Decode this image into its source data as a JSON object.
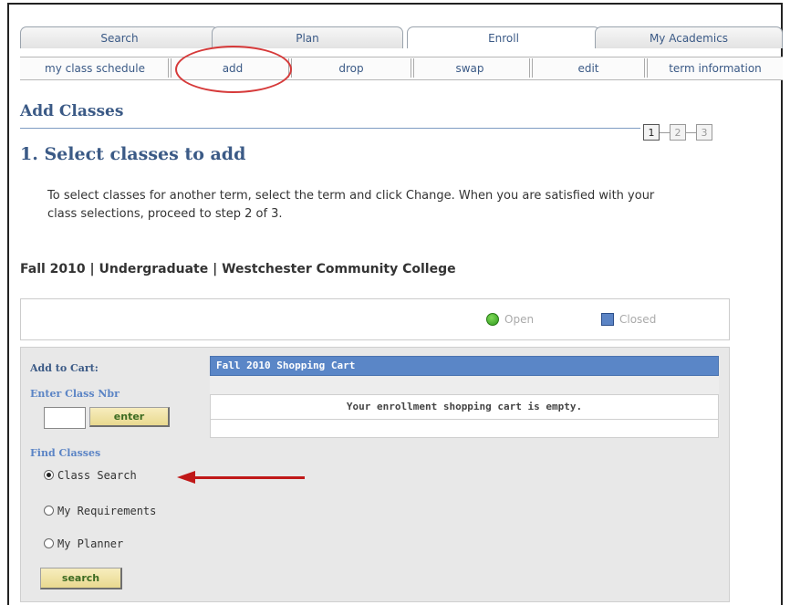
{
  "tabs": [
    "Search",
    "Plan",
    "Enroll",
    "My Academics"
  ],
  "active_tab": "Enroll",
  "subtabs": [
    "my class schedule",
    "add",
    "drop",
    "swap",
    "edit",
    "term information"
  ],
  "active_subtab": "add",
  "page_title": "Add Classes",
  "steps": [
    "1",
    "2",
    "3"
  ],
  "active_step": "1",
  "section_title": "1.  Select classes to add",
  "instructions": "To select classes for another term, select the term and click Change.  When you are satisfied with your class selections, proceed to step 2 of 3.",
  "term_info": "Fall 2010 | Undergraduate | Westchester Community College",
  "legend": {
    "open": "Open",
    "closed": "Closed"
  },
  "left_panel": {
    "add_to_cart": "Add to Cart:",
    "enter_class_nbr": "Enter Class Nbr",
    "enter_button": "enter",
    "find_classes": "Find Classes",
    "options": [
      "Class Search",
      "My Requirements",
      "My Planner"
    ],
    "selected_option": "Class Search",
    "search_button": "search"
  },
  "cart": {
    "title": "Fall 2010 Shopping Cart",
    "empty_message": "Your enrollment shopping cart is empty."
  },
  "colors": {
    "link_blue": "#3b5a86",
    "header_blue": "#5a86c7",
    "annotation_red": "#c01818",
    "open_green": "#2f9a1e"
  }
}
